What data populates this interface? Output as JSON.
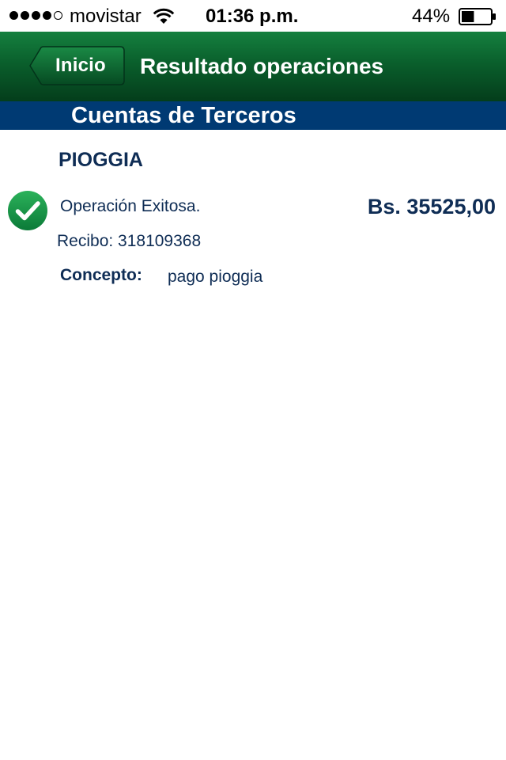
{
  "status_bar": {
    "carrier": "movistar",
    "signal_bars_filled": 4,
    "signal_bars_total": 5,
    "time": "01:36 p.m.",
    "battery_percent": "44%",
    "battery_level": 0.44
  },
  "nav": {
    "back_label": "Inicio",
    "title": "Resultado operaciones"
  },
  "section": {
    "title": "Cuentas de Terceros"
  },
  "result": {
    "beneficiary": "PIOGGIA",
    "status": "Operación Exitosa.",
    "amount": "Bs. 35525,00",
    "receipt": "Recibo: 318109368",
    "concept_label": "Concepto:",
    "concept_value": "pago pioggia"
  },
  "colors": {
    "nav_green": "#0a5f2c",
    "section_blue": "#003a73",
    "text_navy": "#0f2d55",
    "success_green": "#1e9a4b"
  },
  "icons": {
    "wifi": "wifi-icon",
    "battery": "battery-icon",
    "back": "back-arrow-button",
    "status": "check-circle-icon"
  }
}
